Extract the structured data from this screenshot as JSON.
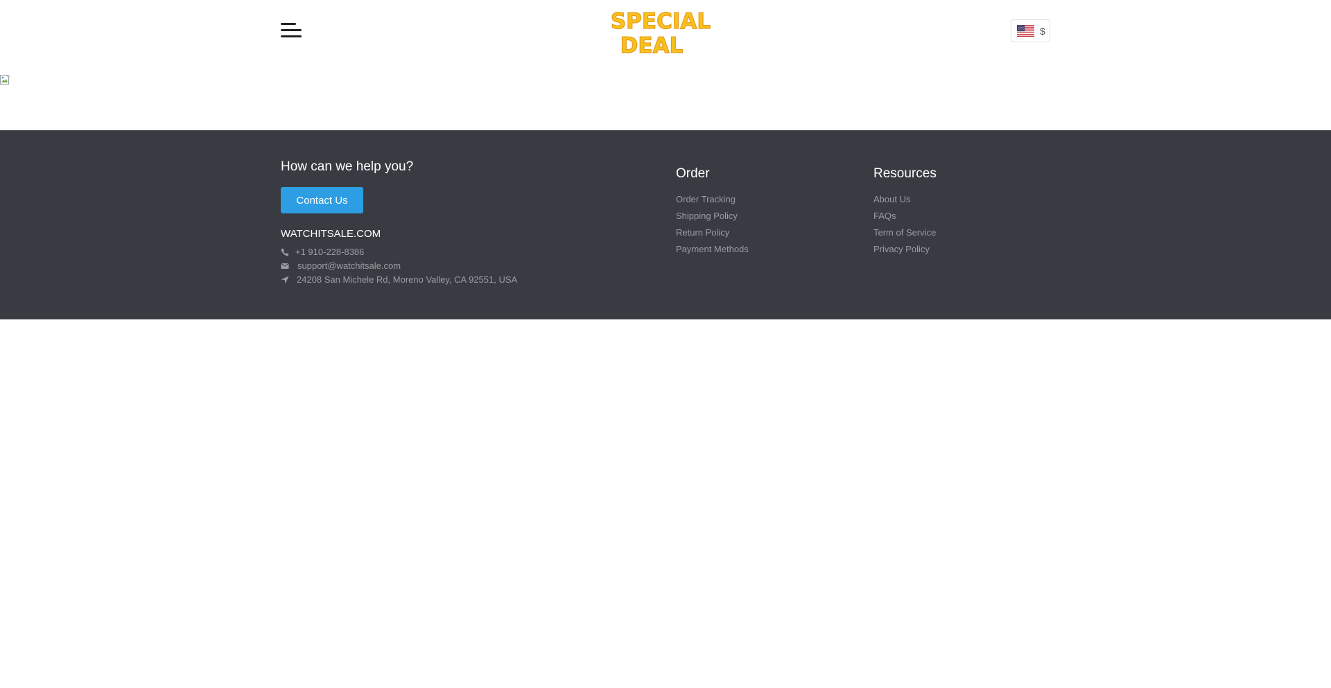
{
  "header": {
    "menu_icon": "hamburger-menu-icon",
    "logo": {
      "line1": "SPECIAL",
      "line2": "DEAL",
      "colors": [
        "#f7c21d",
        "#e89a1a"
      ]
    },
    "locale": {
      "flag_icon": "us-flag-icon",
      "currency": "$"
    }
  },
  "banner": {
    "image_icon": "broken-image-icon"
  },
  "footer": {
    "help_title": "How can we help you?",
    "contact_label": "Contact Us",
    "site_name": "WATCHITSALE.COM",
    "phone": "+1 910-228-8386",
    "email": "support@watchitsale.com",
    "address": "24208 San Michele Rd, Moreno Valley, CA 92551, USA",
    "order": {
      "title": "Order",
      "links": [
        "Order Tracking",
        "Shipping Policy",
        "Return Policy",
        "Payment Methods"
      ]
    },
    "resources": {
      "title": "Resources",
      "links": [
        "About Us",
        "FAQs",
        "Term of Service",
        "Privacy Policy"
      ]
    }
  },
  "colors": {
    "footer_bg": "#383c42",
    "button": "#2d9ee3",
    "muted_text": "#9a9ea3"
  }
}
